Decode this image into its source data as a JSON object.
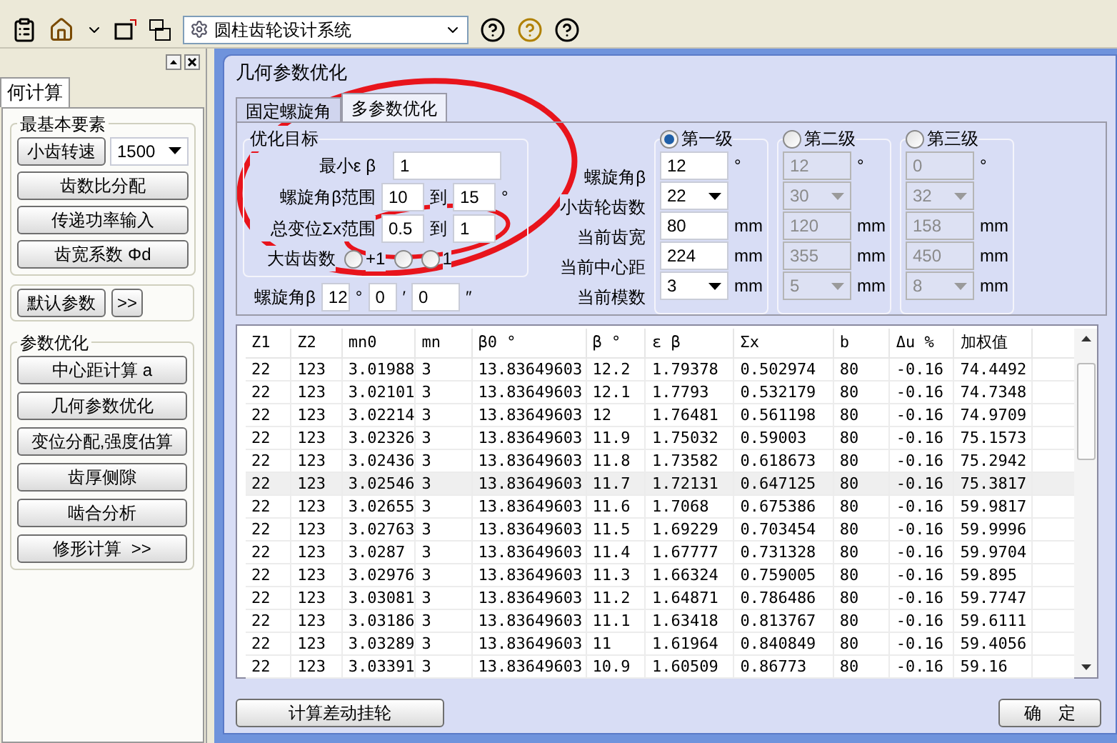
{
  "toolbar": {
    "system_select": "圆柱齿轮设计系统"
  },
  "left_panel": {
    "tab": "何计算",
    "basic": {
      "title": "最基本要素",
      "speed_button": "小齿转速",
      "speed_value": "1500",
      "buttons": [
        "齿数比分配",
        "传递功率输入",
        "齿宽系数 Φd"
      ]
    },
    "defaults": {
      "button": "默认参数",
      "more": ">>"
    },
    "optimize": {
      "title": "参数优化",
      "buttons": [
        "中心距计算 a",
        "几何参数优化",
        "变位分配,强度估算",
        "齿厚侧隙",
        "啮合分析",
        "修形计算  >>"
      ]
    }
  },
  "dialog": {
    "title": "几何参数优化",
    "tabs": [
      {
        "label": "固定螺旋角",
        "selected": false
      },
      {
        "label": "多参数优化",
        "selected": true
      }
    ],
    "objective": {
      "title": "优化目标",
      "min_eb": {
        "label": "最小ε β",
        "value": "1"
      },
      "beta_range": {
        "label": "螺旋角β范围",
        "from": "10",
        "to_word": "到",
        "to": "15",
        "unit": "°"
      },
      "shift_range": {
        "label": "总变位Σx范围",
        "from": "0.5",
        "to_word": "到",
        "to": "1"
      },
      "gear_teeth": {
        "label": "大齿齿数",
        "options": [
          {
            "label": "+1",
            "selected": false
          },
          {
            "selected": false
          },
          {
            "label": "1",
            "selected": false
          }
        ]
      }
    },
    "helix": {
      "label": "螺旋角β",
      "deg": "12",
      "deg_unit": "°",
      "min": "0",
      "min_unit": "′",
      "sec": "0",
      "sec_unit": "″"
    },
    "stage_rows": [
      {
        "label": "螺旋角β",
        "kind": "input"
      },
      {
        "label": "小齿轮齿数",
        "kind": "combo"
      },
      {
        "label": "当前齿宽",
        "kind": "input"
      },
      {
        "label": "当前中心距",
        "kind": "input"
      },
      {
        "label": "当前模数",
        "kind": "combo"
      }
    ],
    "stages": [
      {
        "label": "第一级",
        "selected": true,
        "cells": [
          {
            "value": "12",
            "unit": "°"
          },
          {
            "value": "22"
          },
          {
            "value": "80",
            "unit": "mm"
          },
          {
            "value": "224",
            "unit": "mm"
          },
          {
            "value": "3",
            "unit": "mm"
          }
        ]
      },
      {
        "label": "第二级",
        "selected": false,
        "cells": [
          {
            "value": "12",
            "unit": "°"
          },
          {
            "value": "30"
          },
          {
            "value": "120",
            "unit": "mm"
          },
          {
            "value": "355",
            "unit": "mm"
          },
          {
            "value": "5",
            "unit": "mm"
          }
        ]
      },
      {
        "label": "第三级",
        "selected": false,
        "cells": [
          {
            "value": "0",
            "unit": "°"
          },
          {
            "value": "32"
          },
          {
            "value": "158",
            "unit": "mm"
          },
          {
            "value": "450",
            "unit": "mm"
          },
          {
            "value": "8",
            "unit": "mm"
          }
        ]
      }
    ],
    "table": {
      "columns": [
        "Z1",
        "Z2",
        "mn0",
        "mn",
        "β0 °",
        "β °",
        "ε β",
        "Σx",
        "b",
        "Δu %",
        "加权值"
      ],
      "rows": [
        {
          "selected": false,
          "cells": [
            "22",
            "123",
            "3.01988",
            "3",
            "13.83649603",
            "12.2",
            "1.79378",
            "0.502974",
            "80",
            "-0.16",
            "74.4492"
          ]
        },
        {
          "selected": false,
          "cells": [
            "22",
            "123",
            "3.02101",
            "3",
            "13.83649603",
            "12.1",
            "1.7793",
            "0.532179",
            "80",
            "-0.16",
            "74.7348"
          ]
        },
        {
          "selected": false,
          "cells": [
            "22",
            "123",
            "3.02214",
            "3",
            "13.83649603",
            "12",
            "1.76481",
            "0.561198",
            "80",
            "-0.16",
            "74.9709"
          ]
        },
        {
          "selected": false,
          "cells": [
            "22",
            "123",
            "3.02326",
            "3",
            "13.83649603",
            "11.9",
            "1.75032",
            "0.59003",
            "80",
            "-0.16",
            "75.1573"
          ]
        },
        {
          "selected": false,
          "cells": [
            "22",
            "123",
            "3.02436",
            "3",
            "13.83649603",
            "11.8",
            "1.73582",
            "0.618673",
            "80",
            "-0.16",
            "75.2942"
          ]
        },
        {
          "selected": true,
          "cells": [
            "22",
            "123",
            "3.02546",
            "3",
            "13.83649603",
            "11.7",
            "1.72131",
            "0.647125",
            "80",
            "-0.16",
            "75.3817"
          ]
        },
        {
          "selected": false,
          "cells": [
            "22",
            "123",
            "3.02655",
            "3",
            "13.83649603",
            "11.6",
            "1.7068",
            "0.675386",
            "80",
            "-0.16",
            "59.9817"
          ]
        },
        {
          "selected": false,
          "cells": [
            "22",
            "123",
            "3.02763",
            "3",
            "13.83649603",
            "11.5",
            "1.69229",
            "0.703454",
            "80",
            "-0.16",
            "59.9996"
          ]
        },
        {
          "selected": false,
          "cells": [
            "22",
            "123",
            "3.0287",
            "3",
            "13.83649603",
            "11.4",
            "1.67777",
            "0.731328",
            "80",
            "-0.16",
            "59.9704"
          ]
        },
        {
          "selected": false,
          "cells": [
            "22",
            "123",
            "3.02976",
            "3",
            "13.83649603",
            "11.3",
            "1.66324",
            "0.759005",
            "80",
            "-0.16",
            "59.895"
          ]
        },
        {
          "selected": false,
          "cells": [
            "22",
            "123",
            "3.03081",
            "3",
            "13.83649603",
            "11.2",
            "1.64871",
            "0.786486",
            "80",
            "-0.16",
            "59.7747"
          ]
        },
        {
          "selected": false,
          "cells": [
            "22",
            "123",
            "3.03186",
            "3",
            "13.83649603",
            "11.1",
            "1.63418",
            "0.813767",
            "80",
            "-0.16",
            "59.6111"
          ]
        },
        {
          "selected": false,
          "cells": [
            "22",
            "123",
            "3.03289",
            "3",
            "13.83649603",
            "11",
            "1.61964",
            "0.840849",
            "80",
            "-0.16",
            "59.4056"
          ]
        },
        {
          "selected": false,
          "cells": [
            "22",
            "123",
            "3.03391",
            "3",
            "13.83649603",
            "10.9",
            "1.60509",
            "0.86773",
            "80",
            "-0.16",
            "59.16"
          ]
        }
      ]
    },
    "buttons": [
      "计算差动挂轮",
      "确　定"
    ]
  }
}
